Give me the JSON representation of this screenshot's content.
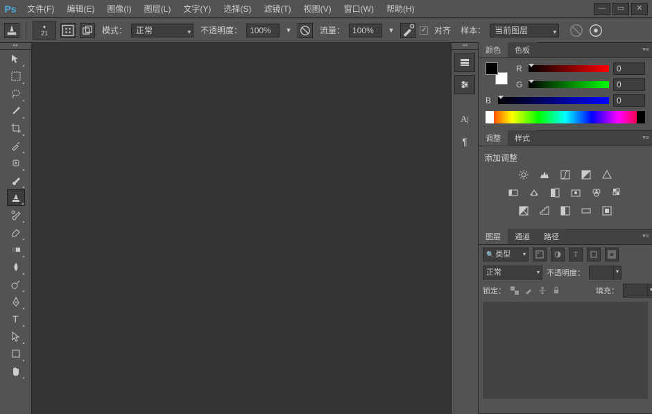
{
  "app": {
    "logo": "Ps"
  },
  "menu": {
    "file": "文件(F)",
    "edit": "编辑(E)",
    "image": "图像(I)",
    "layer": "图层(L)",
    "type": "文字(Y)",
    "select": "选择(S)",
    "filter": "滤镜(T)",
    "view": "视图(V)",
    "window": "窗口(W)",
    "help": "帮助(H)"
  },
  "options": {
    "brush_size": "21",
    "mode_label": "模式：",
    "mode_value": "正常",
    "opacity_label": "不透明度：",
    "opacity_value": "100%",
    "flow_label": "流量：",
    "flow_value": "100%",
    "align_label": "对齐",
    "sample_label": "样本：",
    "sample_value": "当前图层"
  },
  "panels": {
    "color": {
      "tab_color": "颜色",
      "tab_swatches": "色板",
      "r_label": "R",
      "g_label": "G",
      "b_label": "B",
      "r_val": "0",
      "g_val": "0",
      "b_val": "0"
    },
    "adjust": {
      "tab_adjust": "调整",
      "tab_styles": "样式",
      "title": "添加调整"
    },
    "layers": {
      "tab_layers": "图层",
      "tab_channels": "通道",
      "tab_paths": "路径",
      "filter_kind": "类型",
      "blend_mode": "正常",
      "opacity_label": "不透明度：",
      "lock_label": "锁定：",
      "fill_label": "填充："
    }
  }
}
